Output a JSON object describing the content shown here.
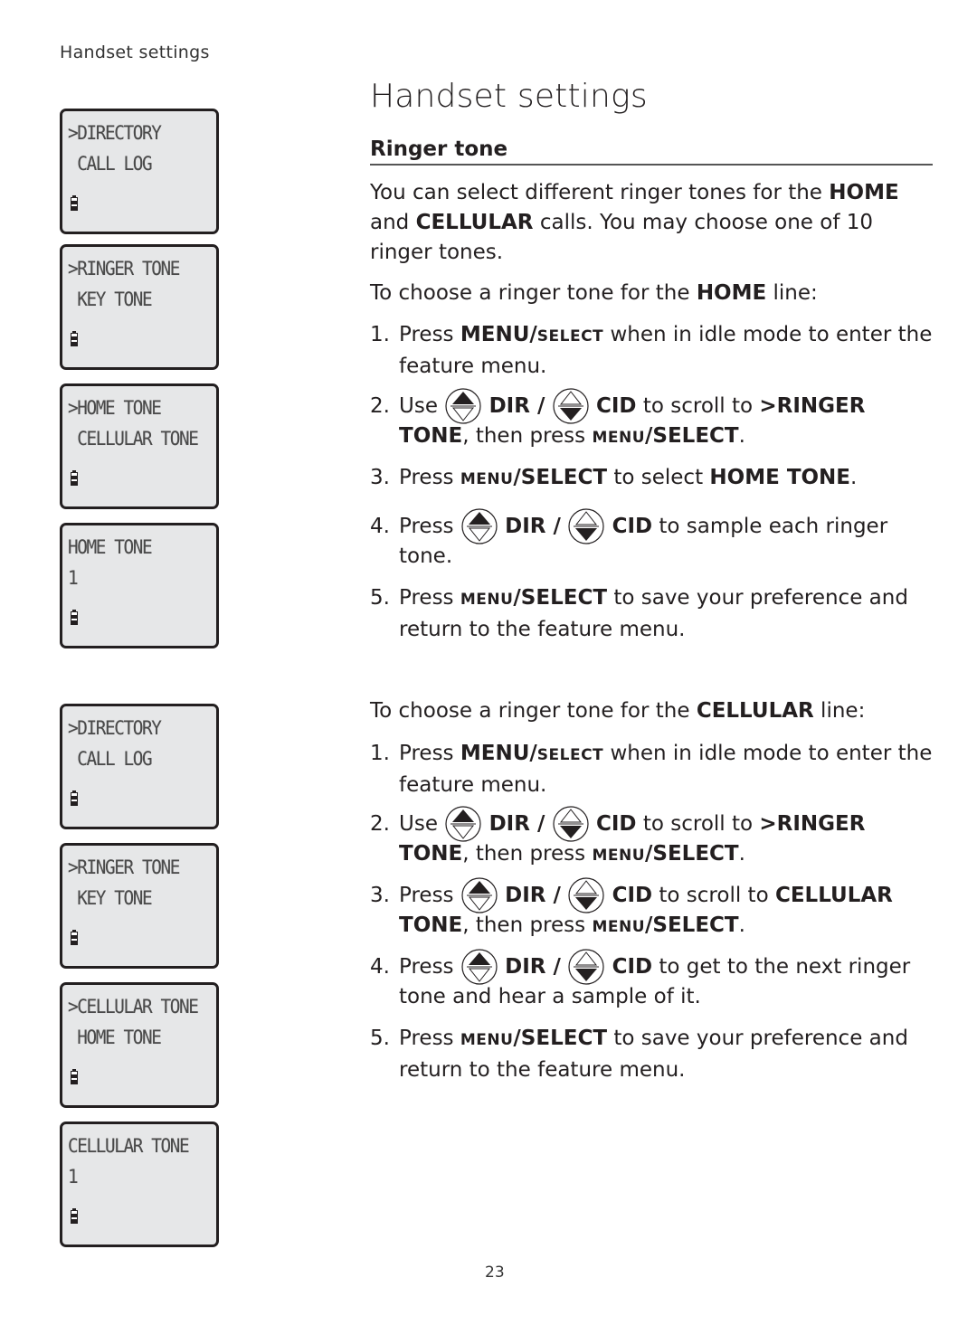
{
  "running_head": "Handset settings",
  "page_number": "23",
  "page_title": "Handset settings",
  "section_heading": "Ringer tone",
  "intro": {
    "t1": "You can select different ringer tones for the ",
    "b1": "HOME",
    "t2": " and ",
    "b2": "CELLULAR",
    "t3": " calls. You may choose one of 10 ringer tones."
  },
  "icons": {
    "dir_key": "up-arrow-key-icon",
    "cid_key": "down-arrow-key-icon",
    "battery": "battery-icon"
  },
  "home": {
    "lead_t1": "To choose a ringer tone for the ",
    "lead_b": "HOME",
    "lead_t2": " line:",
    "steps": [
      {
        "num": "1.",
        "t1": "Press ",
        "b1": "MENU/",
        "sc1": "SELECT",
        "t2": " when in idle mode to enter the feature menu."
      },
      {
        "num": "2.",
        "t1": "Use ",
        "dir": "DIR /",
        "cid": "CID",
        "t2": " to scroll to ",
        "b2": ">RINGER TONE",
        "t3": ", then press ",
        "sc1": "MENU",
        "b3": "/SELECT",
        "t4": "."
      },
      {
        "num": "3.",
        "t1": "Press ",
        "sc1": "MENU",
        "b1": "/SELECT",
        "t2": " to select ",
        "b2": "HOME TONE",
        "t3": "."
      },
      {
        "num": "4.",
        "t1": "Press ",
        "dir": "DIR /",
        "cid": "CID",
        "t2": " to sample each ringer tone."
      },
      {
        "num": "5.",
        "t1": "Press ",
        "sc1": "MENU",
        "b1": "/SELECT",
        "t2": " to save your preference and return to the feature menu."
      }
    ]
  },
  "cellular": {
    "lead_t1": "To choose a ringer tone for the ",
    "lead_b": "CELLULAR",
    "lead_t2": " line:",
    "steps": [
      {
        "num": "1.",
        "t1": "Press ",
        "b1": "MENU/",
        "sc1": "SELECT",
        "t2": " when in idle mode to enter the feature menu."
      },
      {
        "num": "2.",
        "t1": "Use ",
        "dir": "DIR /",
        "cid": "CID",
        "t2": " to scroll to ",
        "b2": ">RINGER TONE",
        "t3": ", then press ",
        "sc1": "MENU",
        "b3": "/SELECT",
        "t4": "."
      },
      {
        "num": "3.",
        "t1": "Press ",
        "dir": "DIR /",
        "cid": "CID",
        "t2": " to scroll to ",
        "b2": "CELLULAR TONE",
        "t3": ", then press ",
        "sc1": "MENU",
        "b3": "/SELECT",
        "t4": "."
      },
      {
        "num": "4.",
        "t1": "Press ",
        "dir": "DIR /",
        "cid": "CID",
        "t2": " to get to the next ringer tone and hear a sample of it."
      },
      {
        "num": "5.",
        "t1": "Press ",
        "sc1": "MENU",
        "b1": "/SELECT",
        "t2": " to save your preference and return to the feature menu."
      }
    ]
  },
  "screens": [
    {
      "line1": ">DIRECTORY",
      "line2": " CALL LOG"
    },
    {
      "line1": ">RINGER TONE",
      "line2": " KEY TONE"
    },
    {
      "line1": ">HOME TONE",
      "line2": " CELLULAR TONE"
    },
    {
      "line1": "HOME TONE",
      "line2": "1"
    },
    {
      "line1": ">DIRECTORY",
      "line2": " CALL LOG"
    },
    {
      "line1": ">RINGER TONE",
      "line2": " KEY TONE"
    },
    {
      "line1": ">CELLULAR TONE",
      "line2": " HOME TONE"
    },
    {
      "line1": "CELLULAR TONE",
      "line2": "1"
    }
  ]
}
